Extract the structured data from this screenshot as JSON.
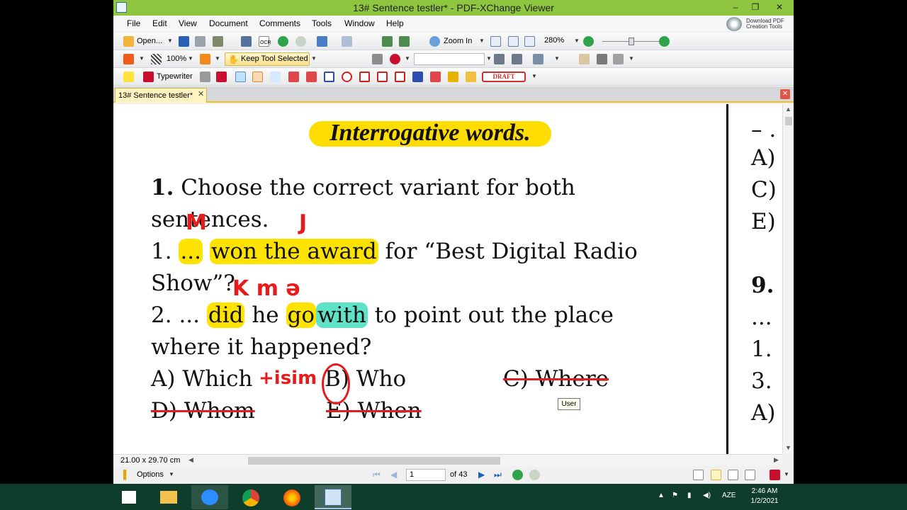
{
  "window": {
    "title": "13# Sentence testler* - PDF-XChange Viewer",
    "min_glyph": "–",
    "max_glyph": "❐",
    "close_glyph": "✕"
  },
  "menu": [
    "File",
    "Edit",
    "View",
    "Document",
    "Comments",
    "Tools",
    "Window",
    "Help"
  ],
  "download_pdf": {
    "line1": "Download PDF",
    "line2": "Creation Tools"
  },
  "toolbar1": {
    "open_label": "Open...",
    "ocr_label": "OCR",
    "zoom_in_label": "Zoom In",
    "zoom_value": "280%"
  },
  "toolbar2": {
    "opacity_value": "100%",
    "keep_tool_label": "Keep Tool Selected"
  },
  "toolbar3": {
    "typewriter_label": "Typewriter",
    "draft_label": "DRAFT"
  },
  "doc_tab": {
    "label": "13# Sentence testler*",
    "close_glyph": "✕"
  },
  "document": {
    "heading": "Interrogative words.",
    "q_number": "1.",
    "q_text": "Choose the correct variant for both",
    "q_text2": "sentences.",
    "s1_num": "1.",
    "s1_dots": "...",
    "s1_hl": "won the award",
    "s1_rest": "for “Best Digital Radio",
    "s1_line2": "Show”?",
    "s2_num": "2.",
    "s2_dots": "...",
    "s2_did": "did",
    "s2_he": "he",
    "s2_go": "go",
    "s2_with": "with",
    "s2_rest": "to point out the place",
    "s2_line2": "where it happened?",
    "opt_a": "A) Which",
    "opt_b": "B) Who",
    "opt_c": "C) Where",
    "opt_d": "D) Whom",
    "opt_e": "E) When"
  },
  "annotations": {
    "ink_1": "M",
    "ink_2": "J",
    "ink_3": "K  m  ə",
    "ink_4": "+isim"
  },
  "right_column": [
    "– .",
    "A)",
    "C)",
    "E)",
    "9.",
    "...",
    "1.",
    "3.",
    "A)"
  ],
  "tooltip": "User",
  "status": {
    "page_size": "21.00 x 29.70 cm",
    "options_label": "Options",
    "page_current": "1",
    "page_total": "of 43"
  },
  "tray": {
    "lang": "AZE",
    "time": "2:46 AM",
    "date": "1/2/2021"
  },
  "colors": {
    "titlebar": "#8ec63f",
    "highlight_yellow": "#ffe300",
    "highlight_teal": "#5fe3c8",
    "ink_red": "#e81b1b",
    "taskbar": "#0f3d2c"
  }
}
